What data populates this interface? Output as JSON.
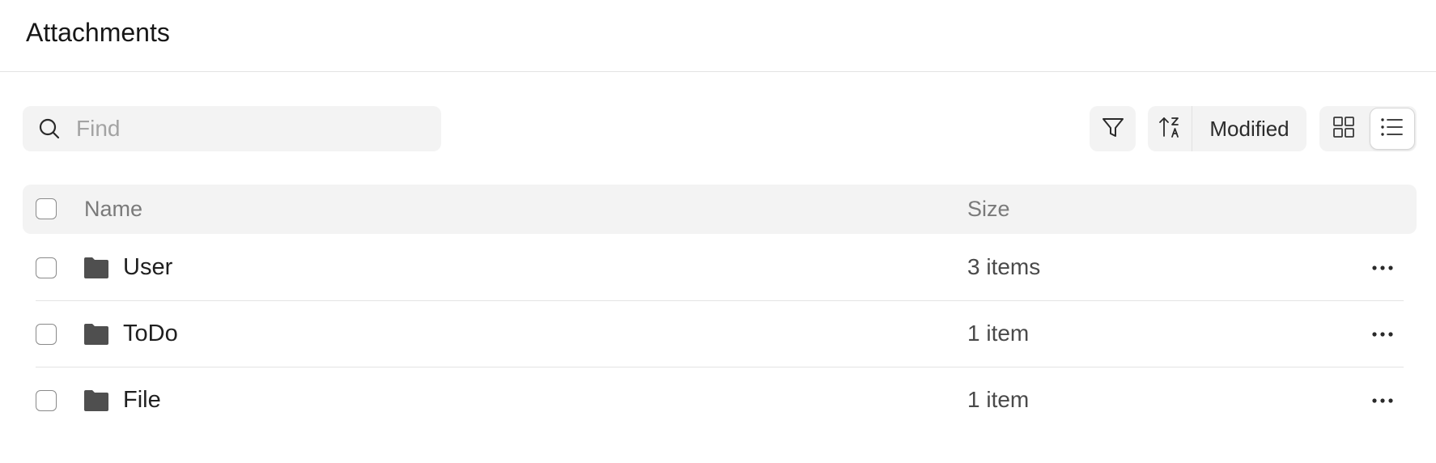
{
  "header": {
    "title": "Attachments"
  },
  "toolbar": {
    "search_placeholder": "Find",
    "search_value": "",
    "search_icon": "search-icon",
    "filter_icon": "filter-icon",
    "sort_icon": "sort-ascending-za-icon",
    "sort_label": "Modified",
    "view_grid_icon": "grid-view-icon",
    "view_list_icon": "list-view-icon",
    "active_view": "list"
  },
  "table": {
    "columns": {
      "name": "Name",
      "size": "Size"
    },
    "rows": [
      {
        "name": "User",
        "size": "3 items",
        "icon": "folder-icon"
      },
      {
        "name": "ToDo",
        "size": "1 item",
        "icon": "folder-icon"
      },
      {
        "name": "File",
        "size": "1 item",
        "icon": "folder-icon"
      }
    ]
  },
  "colors": {
    "panel": "#f3f3f3",
    "folder": "#4f4f4f",
    "text": "#1f1f1f",
    "muted": "#7a7a7a"
  }
}
